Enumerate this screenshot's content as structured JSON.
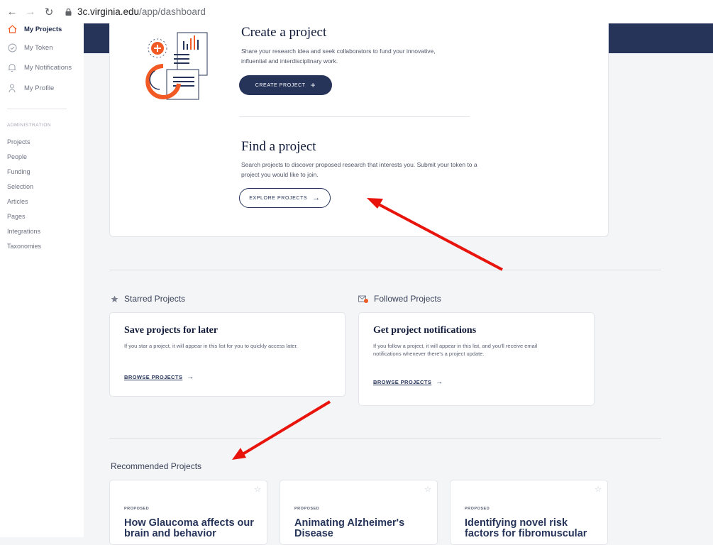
{
  "browser": {
    "back_icon": "arrow-left-icon",
    "forward_icon": "arrow-right-icon",
    "reload_icon": "reload-icon",
    "url_host": "3c.virginia.edu",
    "url_path": "/app/dashboard"
  },
  "sidebar": {
    "items": [
      {
        "label": "My Projects",
        "icon": "home-icon",
        "active": true
      },
      {
        "label": "My Token",
        "icon": "check-circle-icon"
      },
      {
        "label": "My Notifications",
        "icon": "bell-icon"
      },
      {
        "label": "My Profile",
        "icon": "user-icon"
      }
    ],
    "admin_heading": "ADMINISTRATION",
    "admin_links": [
      "Projects",
      "People",
      "Funding",
      "Selection",
      "Articles",
      "Pages",
      "Integrations",
      "Taxonomies"
    ]
  },
  "create": {
    "title": "Create a project",
    "description": "Share your research idea and seek collaborators to fund your innovative, influential and interdisciplinary work.",
    "button": "CREATE PROJECT",
    "button_icon": "+"
  },
  "find": {
    "title": "Find a project",
    "description": "Search projects to discover proposed research that interests you. Submit your token to a project you would like to join.",
    "button": "EXPLORE PROJECTS",
    "button_icon": "→"
  },
  "starred": {
    "label": "Starred Projects",
    "icon": "star-icon",
    "card_title": "Save projects for later",
    "card_desc": "If you star a project, it will appear in this list for you to quickly access later.",
    "link": "BROWSE PROJECTS",
    "link_arrow": "→"
  },
  "followed": {
    "label": "Followed Projects",
    "icon": "mail-notification-icon",
    "card_title": "Get project notifications",
    "card_desc": "If you follow a project, it will appear in this list, and you'll receive email notifications whenever there's a project update.",
    "link": "BROWSE PROJECTS",
    "link_arrow": "→"
  },
  "recommended": {
    "label": "Recommended Projects",
    "cards": [
      {
        "status": "PROPOSED",
        "title": "How Glaucoma affects our brain and behavior"
      },
      {
        "status": "PROPOSED",
        "title": "Animating Alzheimer's Disease"
      },
      {
        "status": "PROPOSED",
        "title": "Identifying novel risk factors for fibromuscular"
      }
    ],
    "star_glyph": "☆"
  },
  "colors": {
    "navy": "#26345a",
    "annotation_red": "#e8140c",
    "illustration_orange": "#f15a24"
  }
}
